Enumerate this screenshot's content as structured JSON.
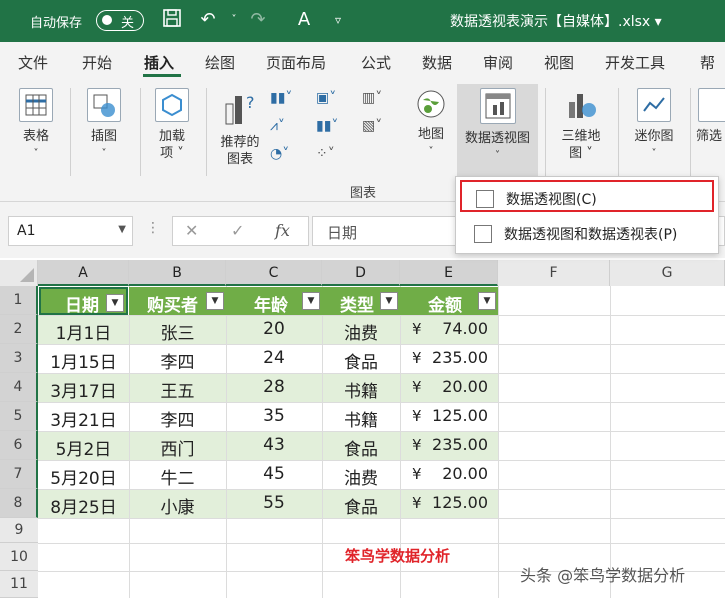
{
  "titlebar": {
    "autosave_label": "自动保存",
    "autosave_state": "关",
    "doc_title": "数据透视表演示【自媒体】.xlsx ▾"
  },
  "tabs": [
    "文件",
    "开始",
    "插入",
    "绘图",
    "页面布局",
    "公式",
    "数据",
    "审阅",
    "视图",
    "开发工具",
    "帮"
  ],
  "active_tab": "插入",
  "ribbon": {
    "tables": "表格",
    "illustrations": "插图",
    "addins_1": "加载",
    "addins_2": "项 ˅",
    "recommended_1": "推荐的",
    "recommended_2": "图表",
    "map": "地图",
    "pivotchart": "数据透视图",
    "map3d_1": "三维地",
    "map3d_2": "图 ˅",
    "sparklines": "迷你图",
    "filter": "筛选",
    "charts_group": "图表"
  },
  "menu": {
    "item1": "数据透视图(C)",
    "item2": "数据透视图和数据透视表(P)"
  },
  "formula_bar": {
    "namebox": "A1",
    "fx": "fx",
    "content": "日期"
  },
  "columns": [
    "A",
    "B",
    "C",
    "D",
    "E",
    "F",
    "G"
  ],
  "rows": [
    "1",
    "2",
    "3",
    "4",
    "5",
    "6",
    "7",
    "8",
    "9",
    "10",
    "11"
  ],
  "table": {
    "headers": [
      "日期",
      "购买者",
      "年龄",
      "类型",
      "金额"
    ],
    "currency": "¥",
    "data": [
      [
        "1月1日",
        "张三",
        "20",
        "油费",
        "74.00"
      ],
      [
        "1月15日",
        "李四",
        "24",
        "食品",
        "235.00"
      ],
      [
        "3月17日",
        "王五",
        "28",
        "书籍",
        "20.00"
      ],
      [
        "3月21日",
        "李四",
        "35",
        "书籍",
        "125.00"
      ],
      [
        "5月2日",
        "西门",
        "43",
        "食品",
        "235.00"
      ],
      [
        "5月20日",
        "牛二",
        "45",
        "油费",
        "20.00"
      ],
      [
        "8月25日",
        "小康",
        "55",
        "食品",
        "125.00"
      ]
    ]
  },
  "watermarks": {
    "red": "笨鸟学数据分析",
    "gray": "头条 @笨鸟学数据分析"
  },
  "colors": {
    "accent": "#217346",
    "header_green": "#70ad47",
    "band_light": "#e2efda",
    "highlight_red": "#e0242a"
  }
}
